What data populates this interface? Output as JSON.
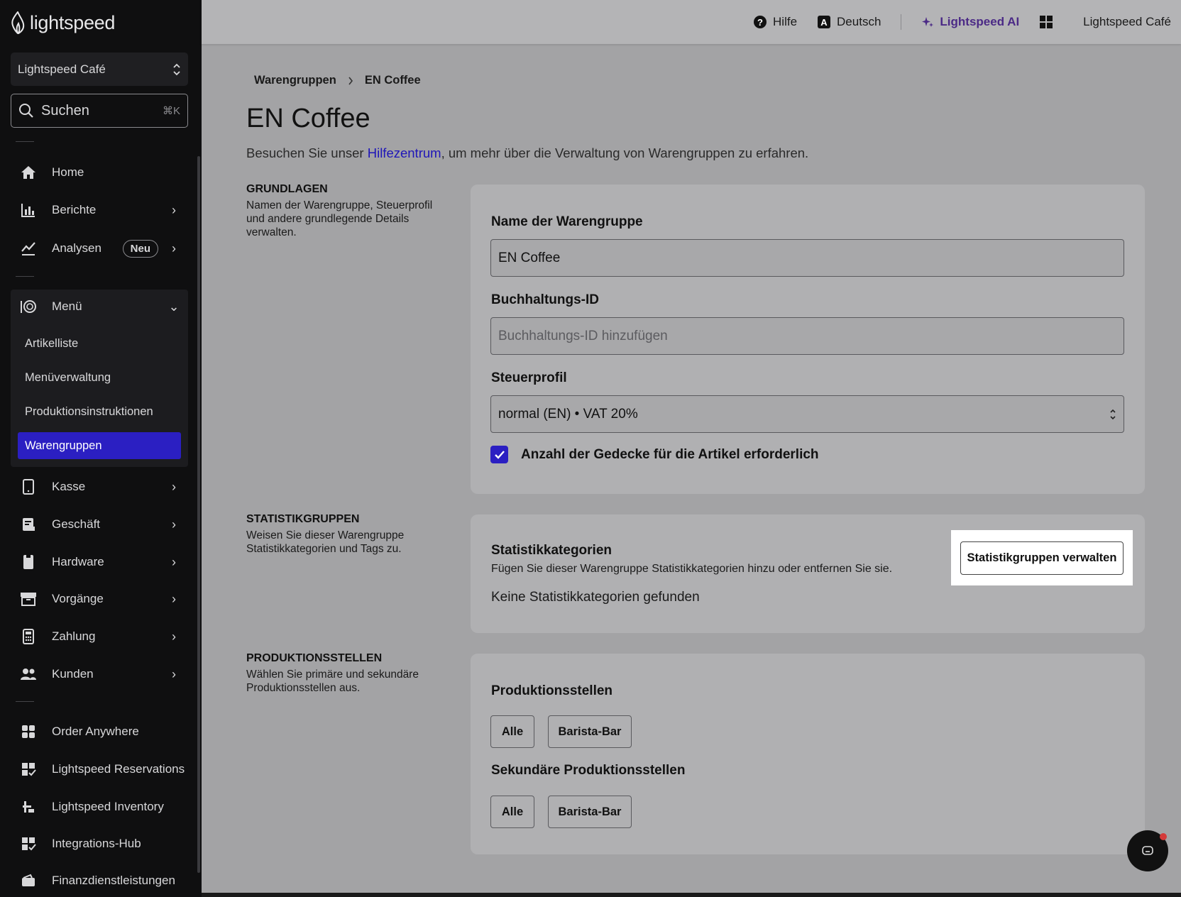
{
  "brand": {
    "name": "lightspeed"
  },
  "sidebar": {
    "store": "Lightspeed Café",
    "search_placeholder": "Suchen",
    "search_shortcut": "⌘K",
    "items": [
      {
        "label": "Home",
        "icon": "home-icon"
      },
      {
        "label": "Berichte",
        "icon": "bar-chart-icon"
      },
      {
        "label": "Analysen",
        "icon": "trend-chart-icon",
        "badge": "Neu"
      },
      {
        "label": "Menü",
        "icon": "menu-dish-icon"
      },
      {
        "label": "Kasse",
        "icon": "tablet-icon"
      },
      {
        "label": "Geschäft",
        "icon": "store-icon"
      },
      {
        "label": "Hardware",
        "icon": "printer-icon"
      },
      {
        "label": "Vorgänge",
        "icon": "archive-icon"
      },
      {
        "label": "Zahlung",
        "icon": "calculator-icon"
      },
      {
        "label": "Kunden",
        "icon": "users-icon"
      },
      {
        "label": "Order Anywhere",
        "icon": "grid-icon"
      },
      {
        "label": "Lightspeed Reservations",
        "icon": "apps-check-icon"
      },
      {
        "label": "Lightspeed Inventory",
        "icon": "inventory-icon"
      },
      {
        "label": "Integrations-Hub",
        "icon": "apps-check-icon"
      },
      {
        "label": "Finanzdienstleistungen",
        "icon": "wallet-icon"
      }
    ],
    "submenu": [
      {
        "label": "Artikelliste"
      },
      {
        "label": "Menüverwaltung"
      },
      {
        "label": "Produktionsinstruktionen"
      },
      {
        "label": "Warengruppen",
        "active": true
      }
    ]
  },
  "topbar": {
    "help": "Hilfe",
    "language": "Deutsch",
    "ai": "Lightspeed AI",
    "account": "Lightspeed Café"
  },
  "breadcrumb": {
    "parent": "Warengruppen",
    "current": "EN Coffee"
  },
  "page": {
    "title": "EN Coffee",
    "help_prefix": "Besuchen Sie unser ",
    "help_link": "Hilfezentrum",
    "help_suffix": ", um mehr über die Verwaltung von Warengruppen zu erfahren."
  },
  "sections": {
    "basics": {
      "heading": "GRUNDLAGEN",
      "description": "Namen der Warengruppe, Steuerprofil und andere grundlegende Details verwalten.",
      "name_label": "Name der Warengruppe",
      "name_value": "EN Coffee",
      "accounting_label": "Buchhaltungs-ID",
      "accounting_placeholder": "Buchhaltungs-ID hinzufügen",
      "tax_label": "Steuerprofil",
      "tax_value": "normal (EN) • VAT 20%",
      "covers_label": "Anzahl der Gedecke für die Artikel erforderlich",
      "covers_checked": true
    },
    "stats": {
      "heading": "STATISTIKGRUPPEN",
      "description": "Weisen Sie dieser Warengruppe Statistikkategorien und Tags zu.",
      "title": "Statistikkategorien",
      "subtitle": "Fügen Sie dieser Warengruppe Statistikkategorien hinzu oder entfernen Sie sie.",
      "empty": "Keine Statistikkategorien gefunden",
      "manage_button": "Statistikgruppen verwalten"
    },
    "production": {
      "heading": "PRODUKTIONSSTELLEN",
      "description": "Wählen Sie primäre und sekundäre Produktionsstellen aus.",
      "primary_title": "Produktionsstellen",
      "secondary_title": "Sekundäre Produktionsstellen",
      "primary_options": [
        "Alle",
        "Barista-Bar"
      ],
      "secondary_options": [
        "Alle",
        "Barista-Bar"
      ]
    }
  },
  "colors": {
    "accent": "#2b1fc2",
    "ai": "#4b2a86",
    "link": "#1f16b8",
    "sidebar_bg": "#0f0f10"
  }
}
